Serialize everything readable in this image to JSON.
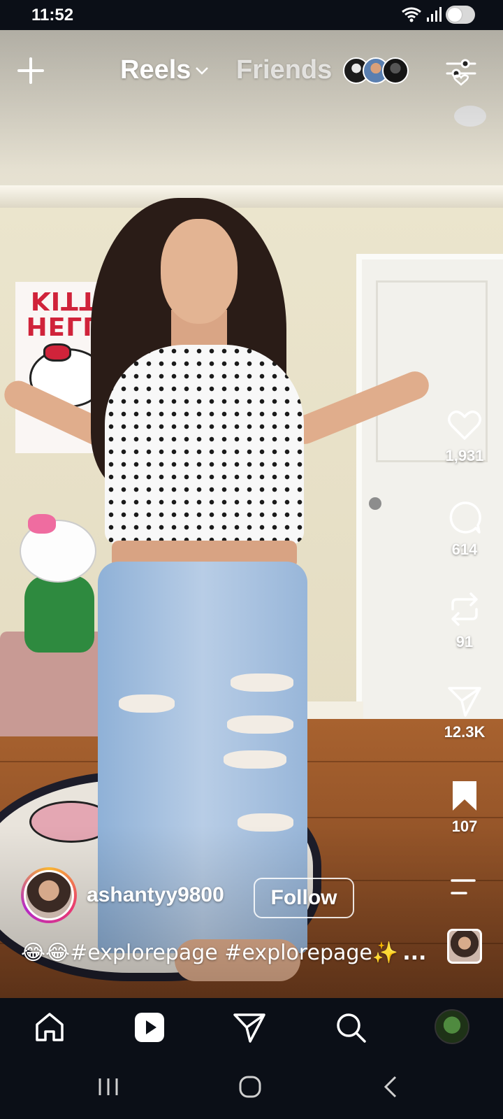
{
  "status_bar": {
    "time": "11:52",
    "icons": [
      "wifi-icon",
      "signal-icon",
      "toggle-icon"
    ]
  },
  "top_nav": {
    "create_icon": "plus-icon",
    "reels_label": "Reels",
    "friends_label": "Friends",
    "filter_icon": "heart-filter-icon"
  },
  "actions": {
    "like_count": "1,931",
    "comment_count": "614",
    "repost_count": "91",
    "share_count": "12.3K",
    "save_count": "107"
  },
  "author": {
    "username": "ashantyy9800",
    "follow_label": "Follow"
  },
  "caption": {
    "emojis": "😂😂",
    "text": "#explorepage #explorepage✨",
    "more": "..."
  },
  "bottom_nav": {
    "items": [
      "home-icon",
      "reels-icon",
      "send-icon",
      "search-icon",
      "profile-avatar"
    ]
  },
  "system_nav": {
    "items": [
      "recents-icon",
      "home-circle-icon",
      "back-icon"
    ]
  },
  "colors": {
    "background": "#0b0f17",
    "text": "#ffffff",
    "story_ring": [
      "#f8b631",
      "#e93872",
      "#b52ac6"
    ]
  }
}
